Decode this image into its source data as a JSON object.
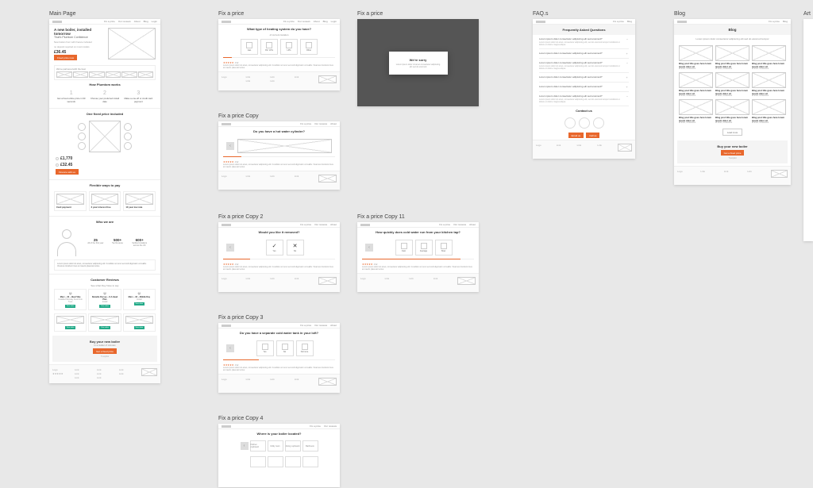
{
  "labels": {
    "main": "Main Page",
    "fix1": "Fix a price",
    "fix_copy": "Fix a price Copy",
    "fix_copy2": "Fix a price Copy 2",
    "fix_copy3": "Fix a price Copy 3",
    "fix_copy4": "Fix a price Copy 4",
    "fix_copy11": "Fix a price Copy 11",
    "fix_modal": "Fix a price",
    "faq": "FAQ.s",
    "blog": "Blog",
    "art": "Art"
  },
  "nav": [
    "Fix a price",
    "Our reviews",
    "About",
    "Blog",
    "Login"
  ],
  "hero": {
    "title": "A new boiler, installed tomorrow",
    "sub": "That's Plumtom Confidence",
    "desc1": "New boilers from with finance included",
    "desc2": "no deposit required on most models",
    "price": "£36.45",
    "cta": "Fixed price now"
  },
  "main": {
    "partner_strip": "We've partnered with the best",
    "how_title": "How Plumtom works",
    "steps": [
      {
        "n": "1",
        "t": "Get a fixed online price in 90 seconds"
      },
      {
        "n": "2",
        "t": "Choose your preferred install date"
      },
      {
        "n": "3",
        "t": "Make a one-off or credit card payment"
      }
    ],
    "one_fixed": "One fixed price included",
    "price1": "£1,770",
    "price2": "£32.45",
    "finance_btn": "Finance with us",
    "flexible": "Flexible ways to pay",
    "pay_cards": [
      "Card payment",
      "2 year interest free",
      "10 year low rate"
    ],
    "who": "Who we are",
    "stats": [
      {
        "v": "25",
        "l": "All of the first year"
      },
      {
        "v": "500+",
        "l": "5★ Reviews"
      },
      {
        "v": "600+",
        "l": "Verified installers across the UK"
      }
    ],
    "testimonial": "Lorem ipsum dolor sit amet, consectetur adipiscing elit. Curabitur at nunc sed velit dignissim convallis. Vivamus tincidunt risus at mauris placerat luctus.",
    "cr_title": "Customer Reviews",
    "cr_sub": "See what they have to say",
    "reviews": [
      {
        "n": "Marc – 32 – Ideal Vibe",
        "s": "Installed Monday fixed from Tues"
      },
      {
        "n": "Danielle Dorsey – 8-A Head Plus"
      },
      {
        "n": "Marc – 32 – Middle Day"
      }
    ],
    "cta_title": "Buy your new boiler",
    "cta_sub": "In a matter of minutes",
    "cta_btn": "Get a fixed price"
  },
  "fix": {
    "q1": "What type of heating system do you have?",
    "q1_opts": [
      "Gas",
      "Oil / LPG",
      "LPG",
      "Other"
    ],
    "q2": "Do you have a hot water cylinder?",
    "q3": "Would you like it removed?",
    "q3_opts": [
      "Yes",
      "No"
    ],
    "q4": "Do you have a separate cold water tank in your loft?",
    "q4_opts": [
      "Yes",
      "No",
      "Not sure"
    ],
    "q5": "Where is your boiler located?",
    "q5_opts": [
      "Kitchen cupboard",
      "Utility room",
      "Airing cupboard",
      "Bathroom"
    ],
    "q11": "How quickly does cold water run from your kitchen tap?",
    "q11_opts": [
      "Fast",
      "Average",
      "Slow"
    ],
    "sub": "of current location",
    "stars_label": "4.92"
  },
  "modal": {
    "title": "We're sorry",
    "text": "Lorem ipsum dolor sit amet consectetur adipiscing elit sed do eiusmod"
  },
  "faq": {
    "title": "Frequently Asked Questions",
    "q_short": "Lorem ipsum dolor consectetur adipiscing elit sed eiusmod?",
    "ans": "Lorem ipsum dolor sit amet, consectetur adipiscing elit, sed do eiusmod tempor incididunt ut labore et dolore magna aliqua.",
    "contact": "Contact us",
    "btn1": "Email us",
    "btn2": "Call us"
  },
  "blog": {
    "title": "Blog",
    "sub": "Lorem ipsum dolor consectetur adipiscing elit sed do eiusmod tempor",
    "card_title": "Blog post title goes here lorem ipsum dolor sit",
    "card_text": "sit amet, consectetur",
    "load": "Load more",
    "cta_title": "Buy your new boiler",
    "cta_btn": "Get a fixed price"
  }
}
